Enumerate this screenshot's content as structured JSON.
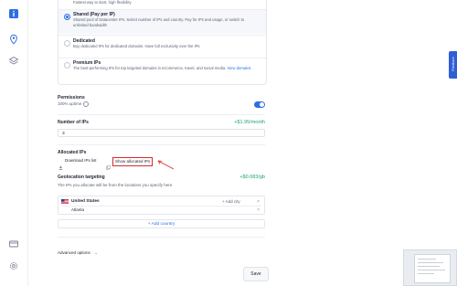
{
  "colors": {
    "accent": "#2e6ee6",
    "price": "#21a567",
    "highlight": "#d62b2b",
    "edge_tab": "#2e5fd6"
  },
  "sidebar": {
    "icons": [
      "info-icon",
      "location-pin-icon",
      "layers-icon",
      "card-icon",
      "settings-gear-icon"
    ]
  },
  "plans": {
    "first_desc": "Fastest way to start, high flexibility",
    "options": [
      {
        "title": "Shared (Pay per IP)",
        "desc": "Shared pool of Datacenter IPs. Select number of IPs and country. Pay for IPs and usage, or switch to unlimited bandwidth",
        "selected": true
      },
      {
        "title": "Dedicated",
        "desc": "Buy dedicated IPs for dedicated domains. Have full exclusivity over the IPs",
        "selected": false
      },
      {
        "title": "Premium IPs",
        "desc": "The best-performing IPs for top targeted domains in eCommerce, travel, and social media.",
        "link": "View domains",
        "selected": false
      }
    ]
  },
  "permissions": {
    "label": "Permissions",
    "uptime": "100% uptime",
    "toggle_on": true
  },
  "num_ips": {
    "label": "Number of IPs",
    "price": "+$1.95/month",
    "value": "3"
  },
  "allocated": {
    "label": "Allocated IPs",
    "download": "Download IPs list",
    "show_button": "Show allocated IPs"
  },
  "geo": {
    "label": "Geolocation targeting",
    "price": "+$0.083/gb",
    "desc": "The IPs you allocate will be from the locations you specify here",
    "country": "United States",
    "add_city": "Add city",
    "city": "Atlanta",
    "add_country": "+ Add country"
  },
  "advanced": "Advanced options",
  "save": "Save",
  "edge_tab": "Feedback"
}
